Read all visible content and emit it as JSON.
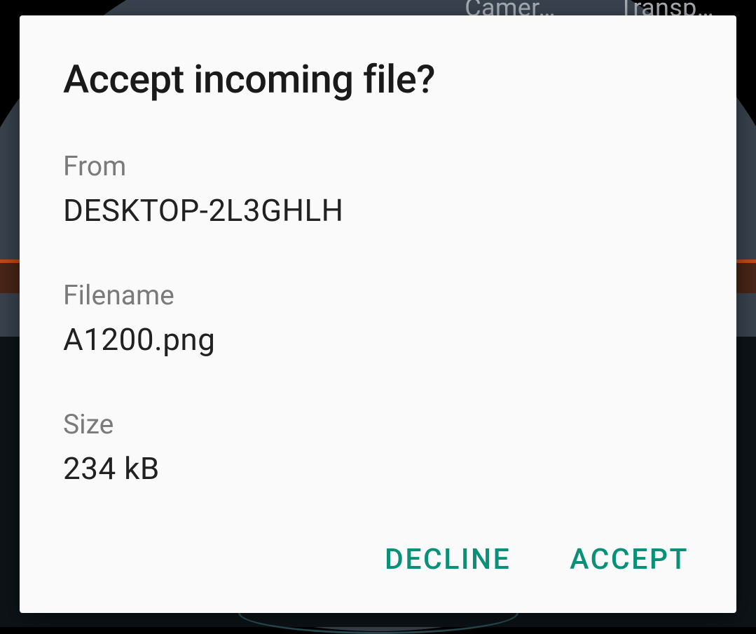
{
  "background": {
    "header_labels": [
      "Camer…",
      "Transp…"
    ]
  },
  "dialog": {
    "title": "Accept incoming file?",
    "fields": {
      "from": {
        "label": "From",
        "value": "DESKTOP-2L3GHLH"
      },
      "filename": {
        "label": "Filename",
        "value": "A1200.png"
      },
      "size": {
        "label": "Size",
        "value": "234 kB"
      }
    },
    "actions": {
      "decline": "DECLINE",
      "accept": "ACCEPT"
    }
  }
}
